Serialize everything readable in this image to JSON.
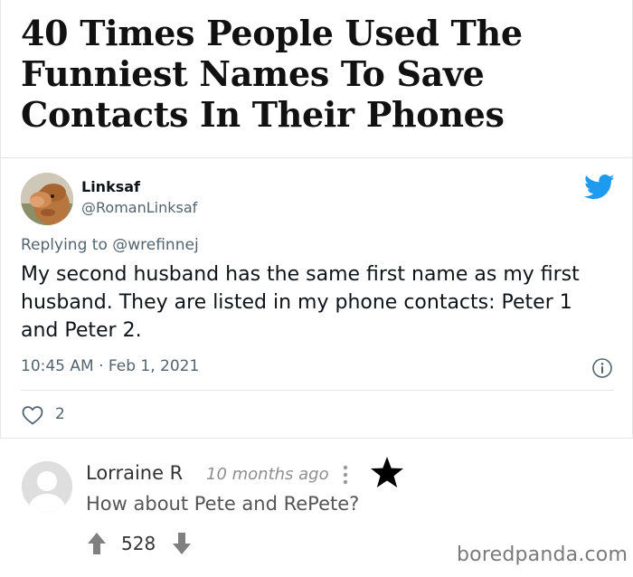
{
  "article": {
    "title": "40 Times People Used The Funniest Names To Save Contacts In Their Phones"
  },
  "tweet": {
    "display_name": "Linksaf",
    "handle": "@RomanLinksaf",
    "replying_prefix": "Replying to",
    "replying_to": "@wrefinnej",
    "text": "My second husband has the same first name as my first husband. They are listed in my phone contacts: Peter 1 and Peter 2.",
    "timestamp": "10:45 AM · Feb 1, 2021",
    "likes": "2",
    "accent_color": "#1d9bf0"
  },
  "comment": {
    "author": "Lorraine R",
    "time_ago": "10 months ago",
    "text": "How about Pete and RePete?",
    "votes": "528"
  },
  "watermark": "boredpanda.com"
}
